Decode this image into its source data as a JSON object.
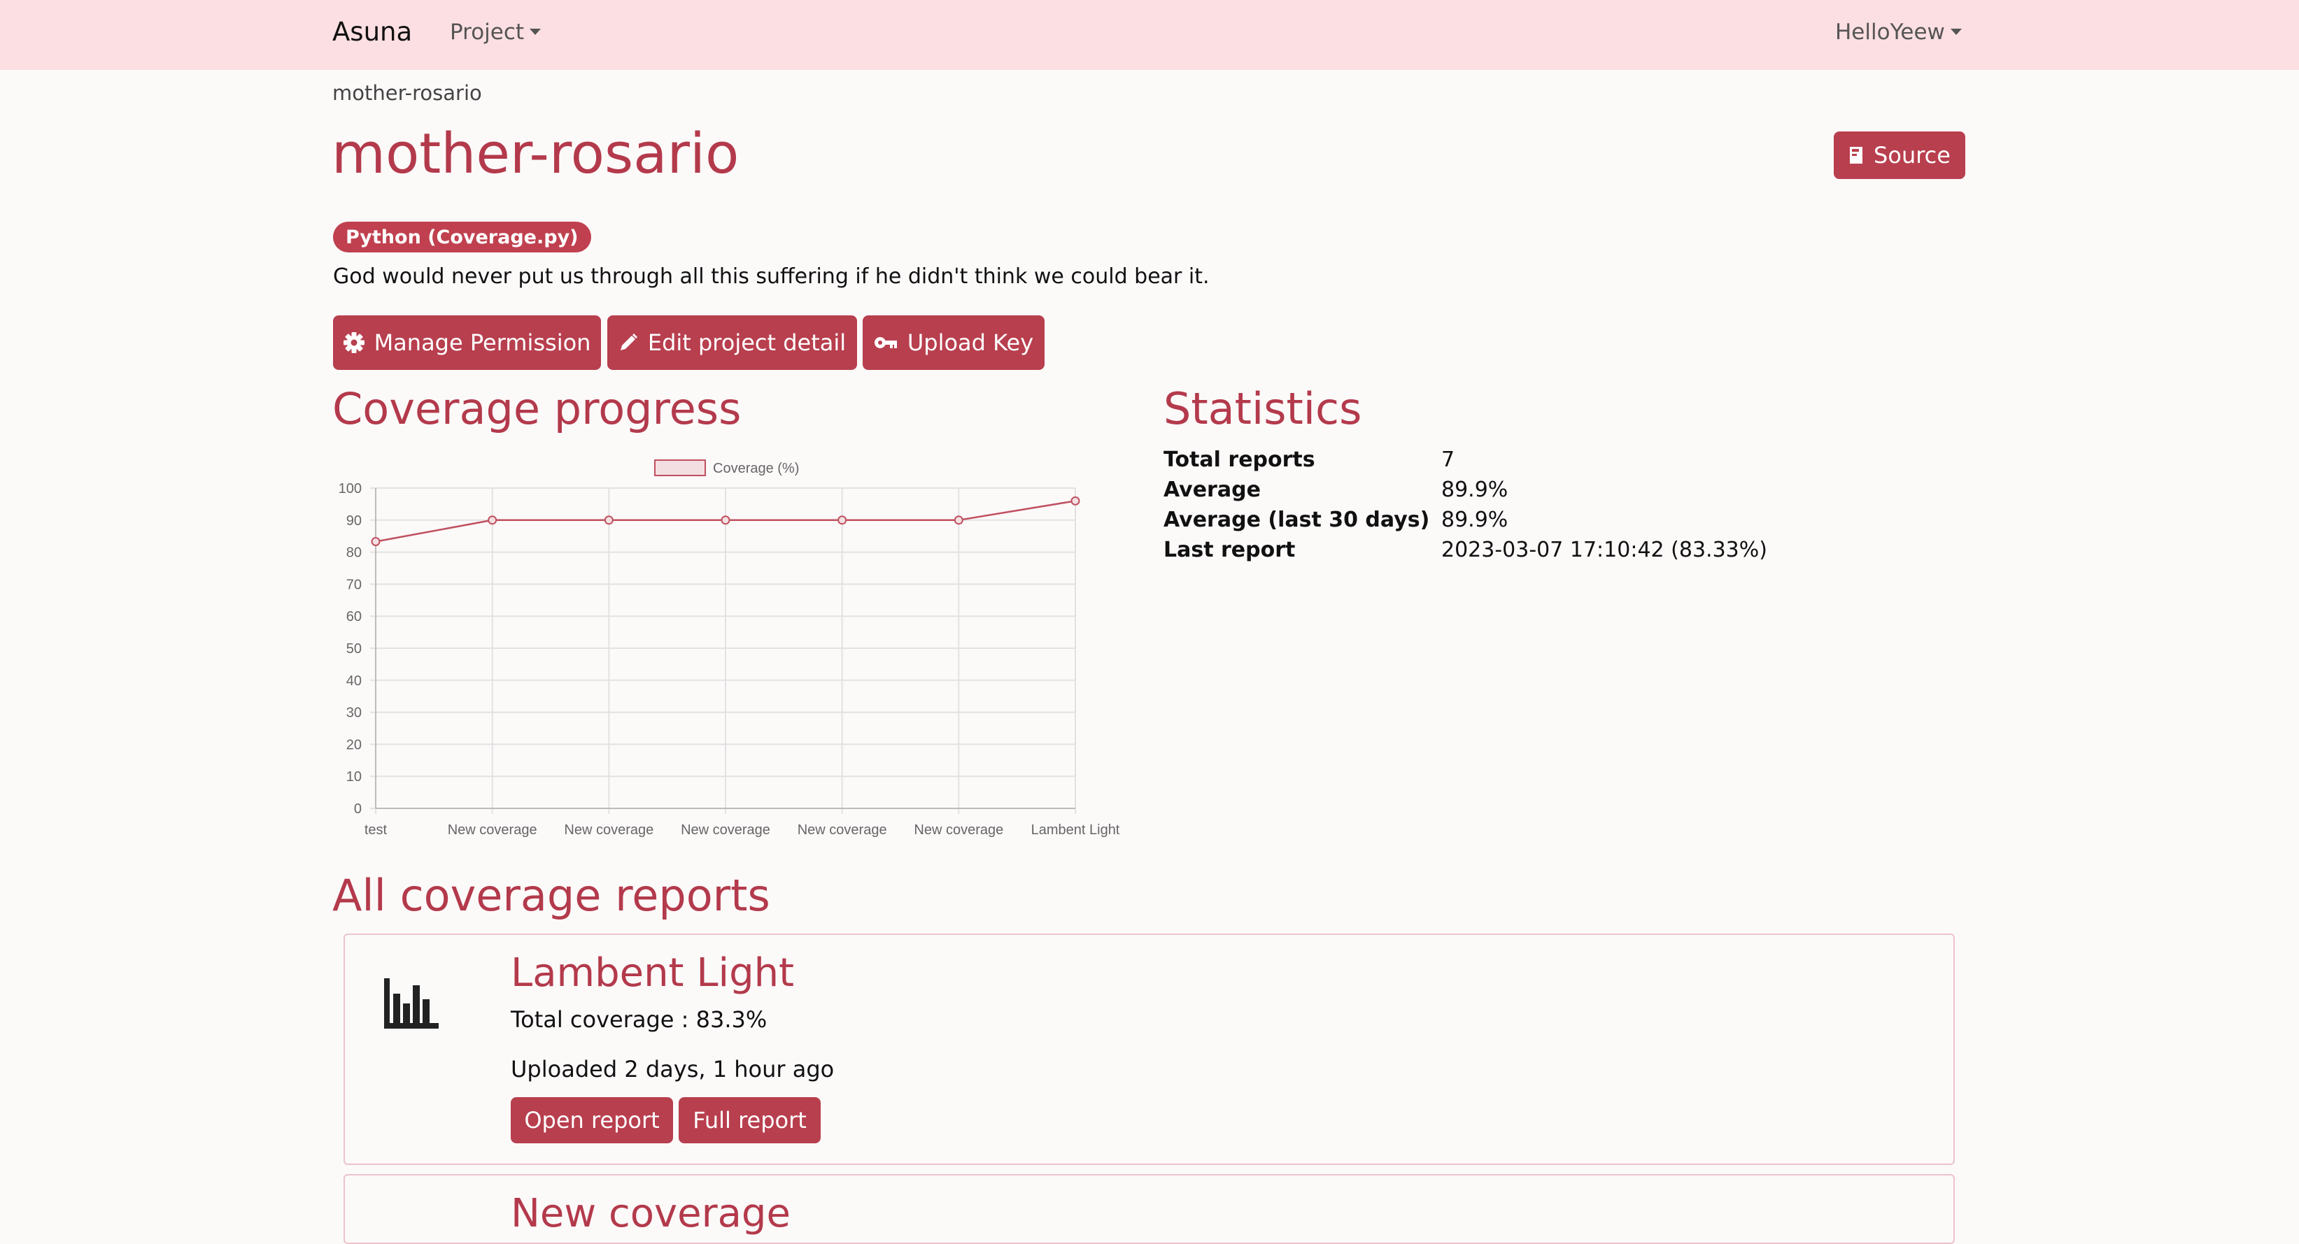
{
  "navbar": {
    "brand": "Asuna",
    "project_menu": "Project",
    "user_menu": "HelloYeew"
  },
  "breadcrumb": "mother-rosario",
  "page_title": "mother-rosario",
  "source_button": "Source",
  "language_badge": "Python (Coverage.py)",
  "description": "God would never put us through all this suffering if he didn't think we could bear it.",
  "actions": {
    "manage_permission": "Manage Permission",
    "edit_project": "Edit project detail",
    "upload_key": "Upload Key"
  },
  "coverage_heading": "Coverage progress",
  "statistics_heading": "Statistics",
  "statistics": [
    {
      "label": "Total reports",
      "value": "7"
    },
    {
      "label": "Average",
      "value": "89.9%"
    },
    {
      "label": "Average (last 30 days)",
      "value": "89.9%"
    },
    {
      "label": "Last report",
      "value": "2023-03-07 17:10:42 (83.33%)"
    }
  ],
  "reports_heading": "All coverage reports",
  "reports": [
    {
      "title": "Lambent Light",
      "total_coverage": "Total coverage : 83.3%",
      "uploaded": "Uploaded 2 days, 1 hour ago",
      "open_report": "Open report",
      "full_report": "Full report"
    },
    {
      "title": "New coverage"
    }
  ],
  "colors": {
    "accent": "#b83f4e",
    "navbar_bg": "#fcdfe2",
    "page_bg": "#fcf9f9"
  },
  "chart_data": {
    "type": "line",
    "categories": [
      "test",
      "New coverage",
      "New coverage",
      "New coverage",
      "New coverage",
      "New coverage",
      "Lambent Light"
    ],
    "series": [
      {
        "name": "Coverage (%)",
        "values": [
          83.3,
          90,
          90,
          90,
          90,
          90,
          96
        ]
      }
    ],
    "ylim": [
      0,
      100
    ],
    "yticks": [
      0,
      10,
      20,
      30,
      40,
      50,
      60,
      70,
      80,
      90,
      100
    ],
    "grid": true,
    "legend": "top-center",
    "color": "#c0505e"
  }
}
